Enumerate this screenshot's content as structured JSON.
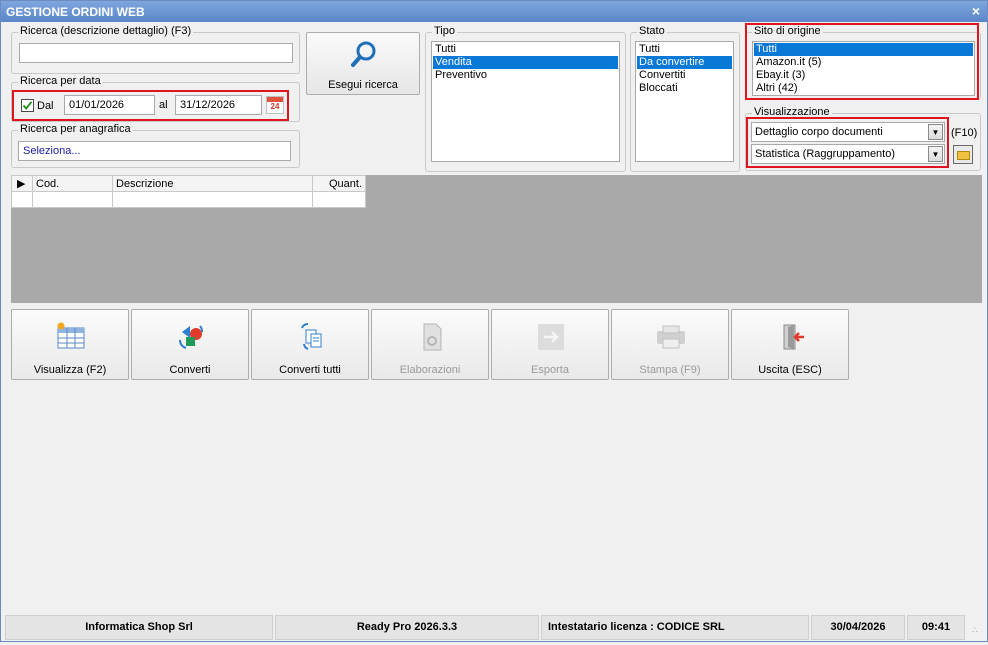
{
  "window": {
    "title": "GESTIONE ORDINI WEB",
    "close_glyph": "×"
  },
  "search_detail": {
    "legend": "Ricerca (descrizione dettaglio) (F3)",
    "value": ""
  },
  "search_date": {
    "legend": "Ricerca per data",
    "checkbox_label": "Dal",
    "checked": true,
    "from": "01/01/2026",
    "to_label": "al",
    "to": "31/12/2026",
    "calendar_day": "24"
  },
  "search_registry": {
    "legend": "Ricerca per anagrafica",
    "value": "Seleziona..."
  },
  "search_button": {
    "label": "Esegui ricerca"
  },
  "tipo": {
    "legend": "Tipo",
    "items": [
      "Tutti",
      "Vendita",
      "Preventivo"
    ],
    "selected": 1
  },
  "stato": {
    "legend": "Stato",
    "items": [
      "Tutti",
      "Da convertire",
      "Convertiti",
      "Bloccati"
    ],
    "selected": 1
  },
  "sito": {
    "legend": "Sito di origine",
    "items": [
      "Tutti",
      "Amazon.it (5)",
      "Ebay.it (3)",
      "Altri (42)"
    ],
    "selected": 0
  },
  "visualizzazione": {
    "legend": "Visualizzazione",
    "combo1": "Dettaglio corpo documenti",
    "combo2": "Statistica (Raggruppamento)",
    "shortcut": "(F10)"
  },
  "grid": {
    "columns": [
      "Cod.",
      "Descrizione",
      "Quant."
    ]
  },
  "actions": [
    {
      "label": "Visualizza (F2)",
      "icon": "table-view-icon",
      "enabled": true
    },
    {
      "label": "Converti",
      "icon": "convert-icon",
      "enabled": true
    },
    {
      "label": "Converti tutti",
      "icon": "convert-all-icon",
      "enabled": true
    },
    {
      "label": "Elaborazioni",
      "icon": "processing-icon",
      "enabled": false
    },
    {
      "label": "Esporta",
      "icon": "export-icon",
      "enabled": false
    },
    {
      "label": "Stampa (F9)",
      "icon": "print-icon",
      "enabled": false
    },
    {
      "label": "Uscita (ESC)",
      "icon": "exit-icon",
      "enabled": true
    }
  ],
  "status": {
    "company": "Informatica Shop Srl",
    "version": "Ready Pro 2026.3.3",
    "license": "Intestatario licenza : CODICE SRL",
    "date": "30/04/2026",
    "time": "09:41"
  },
  "colors": {
    "selection": "#0a78d7",
    "highlight": "#e0141e",
    "title_bar": "#5a86c9"
  }
}
